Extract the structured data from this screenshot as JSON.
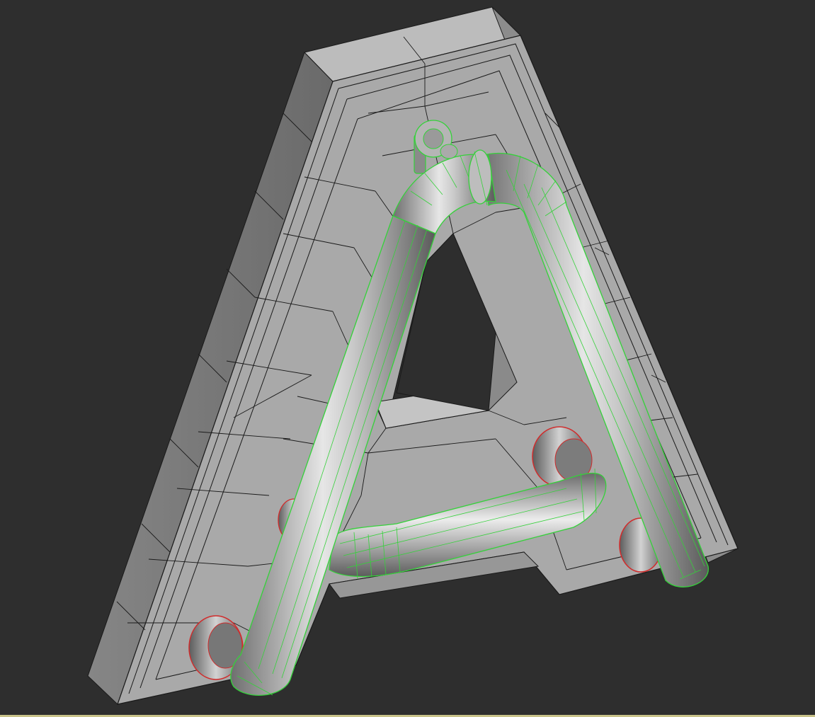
{
  "viewport": {
    "background_color": "#2e2e2e",
    "border_color": "#c9c38a"
  },
  "model": {
    "letter_shape": "A",
    "letter_fill_front": "#a6a6a6",
    "letter_fill_side": "#7a7a7a",
    "letter_fill_top": "#bdbdbd",
    "wireframe_color": "#1a1a1a",
    "tube_wire_color": "#35d13a",
    "clip_wire_color": "#d12b2b"
  },
  "scene_objects": [
    {
      "name": "letter-a-body",
      "kind": "extruded-letter"
    },
    {
      "name": "neon-tube",
      "kind": "bent-tube",
      "selected": true
    },
    {
      "name": "tube-clip",
      "kind": "clip",
      "count": 4
    },
    {
      "name": "tube-connector",
      "kind": "connector",
      "selected": true
    }
  ]
}
